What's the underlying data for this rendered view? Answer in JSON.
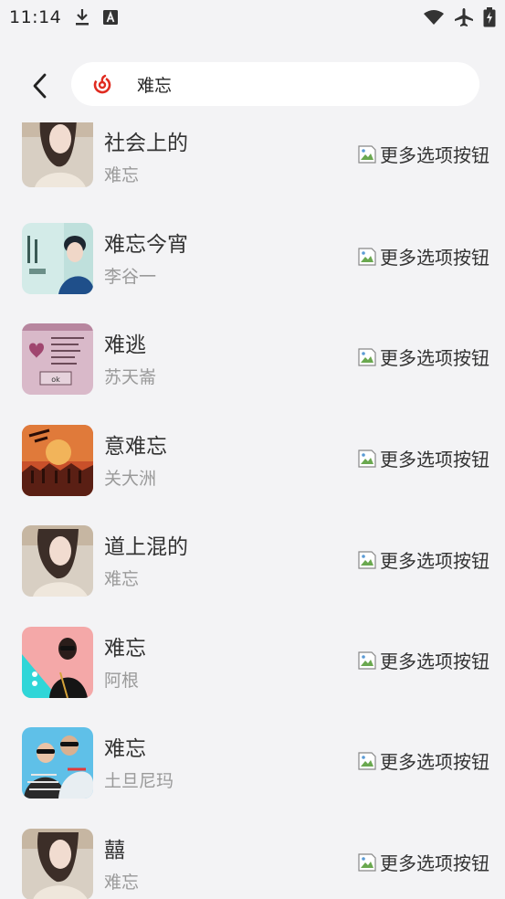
{
  "status_bar": {
    "time": "11:14"
  },
  "search": {
    "query": "难忘"
  },
  "colors": {
    "background": "#f3f3f5",
    "brand_red": "#e02b20",
    "secondary_text": "#9a9a9a"
  },
  "songs": [
    {
      "title": "社会上的",
      "artist": "难忘",
      "more_label": "更多选项按钮"
    },
    {
      "title": "难忘今宵",
      "artist": "李谷一",
      "more_label": "更多选项按钮"
    },
    {
      "title": "难逃",
      "artist": "苏天崙",
      "more_label": "更多选项按钮"
    },
    {
      "title": "意难忘",
      "artist": "关大洲",
      "more_label": "更多选项按钮"
    },
    {
      "title": "道上混的",
      "artist": "难忘",
      "more_label": "更多选项按钮"
    },
    {
      "title": "难忘",
      "artist": "阿根",
      "more_label": "更多选项按钮"
    },
    {
      "title": "难忘",
      "artist": "土旦尼玛",
      "more_label": "更多选项按钮"
    },
    {
      "title": "囍",
      "artist": "难忘",
      "more_label": "更多选项按钮"
    }
  ],
  "cover3_text": {
    "button": "ok"
  }
}
